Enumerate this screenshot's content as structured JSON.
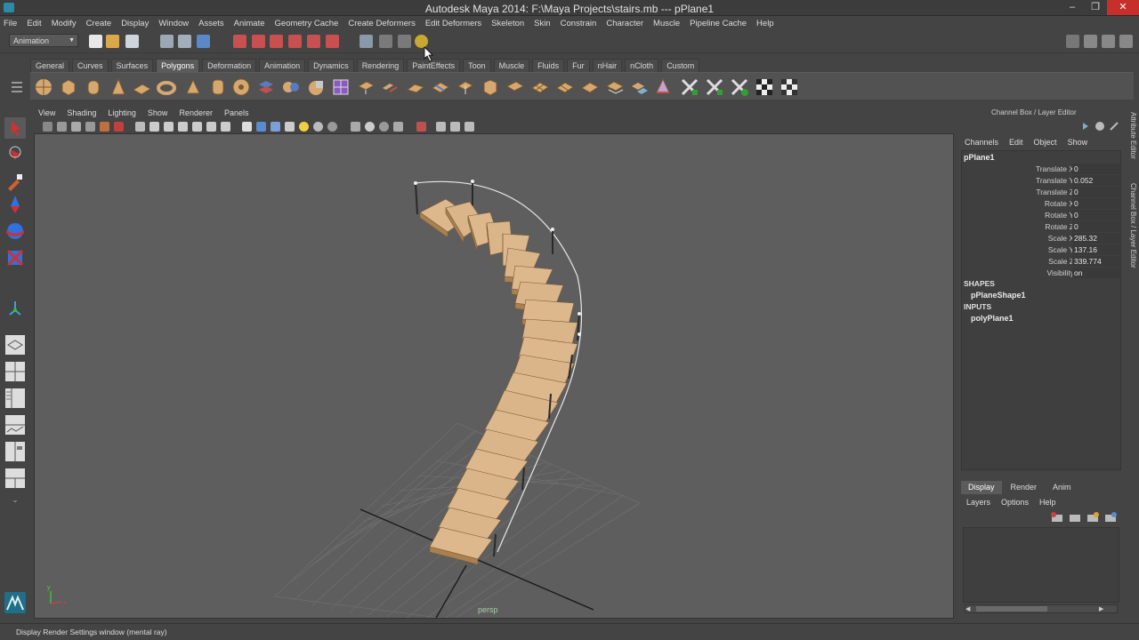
{
  "window": {
    "title": "Autodesk Maya 2014: F:\\Maya Projects\\stairs.mb   ---   pPlane1",
    "minimize": "‒",
    "restore": "❐",
    "close": "✕"
  },
  "menubar": {
    "items": [
      "File",
      "Edit",
      "Modify",
      "Create",
      "Display",
      "Window",
      "Assets",
      "Animate",
      "Geometry Cache",
      "Create Deformers",
      "Edit Deformers",
      "Skeleton",
      "Skin",
      "Constrain",
      "Character",
      "Muscle",
      "Pipeline Cache",
      "Help"
    ]
  },
  "statusline": {
    "mode": "Animation"
  },
  "shelf": {
    "tabs": [
      "General",
      "Curves",
      "Surfaces",
      "Polygons",
      "Deformation",
      "Animation",
      "Dynamics",
      "Rendering",
      "PaintEffects",
      "Toon",
      "Muscle",
      "Fluids",
      "Fur",
      "nHair",
      "nCloth",
      "Custom"
    ],
    "active": "Polygons"
  },
  "viewport": {
    "menu": [
      "View",
      "Shading",
      "Lighting",
      "Show",
      "Renderer",
      "Panels"
    ],
    "camera": "persp",
    "axis_x": "x",
    "axis_y": "y"
  },
  "channelbox": {
    "header": "Channel Box / Layer Editor",
    "menu": [
      "Channels",
      "Edit",
      "Object",
      "Show"
    ],
    "object": "pPlane1",
    "attributes": [
      {
        "label": "Translate X",
        "value": "0"
      },
      {
        "label": "Translate Y",
        "value": "0.052"
      },
      {
        "label": "Translate Z",
        "value": "0"
      },
      {
        "label": "Rotate X",
        "value": "0"
      },
      {
        "label": "Rotate Y",
        "value": "0"
      },
      {
        "label": "Rotate Z",
        "value": "0"
      },
      {
        "label": "Scale X",
        "value": "285.32"
      },
      {
        "label": "Scale Y",
        "value": "137.16"
      },
      {
        "label": "Scale Z",
        "value": "339.774"
      },
      {
        "label": "Visibility",
        "value": "on"
      }
    ],
    "shapes_label": "SHAPES",
    "shape": "pPlaneShape1",
    "inputs_label": "INPUTS",
    "input": "polyPlane1"
  },
  "sidetabs": {
    "attribute_editor": "Attribute Editor",
    "channel_box": "Channel Box / Layer Editor"
  },
  "layereditor": {
    "tabs": [
      "Display",
      "Render",
      "Anim"
    ],
    "active": "Display",
    "menu": [
      "Layers",
      "Options",
      "Help"
    ]
  },
  "helpline": {
    "text": "Display Render Settings window (mental ray)"
  },
  "colors": {
    "viewport_bg": "#5e5e5e",
    "ui_bg": "#444444",
    "wood": "#d9b48a",
    "close_btn": "#c7302a"
  }
}
